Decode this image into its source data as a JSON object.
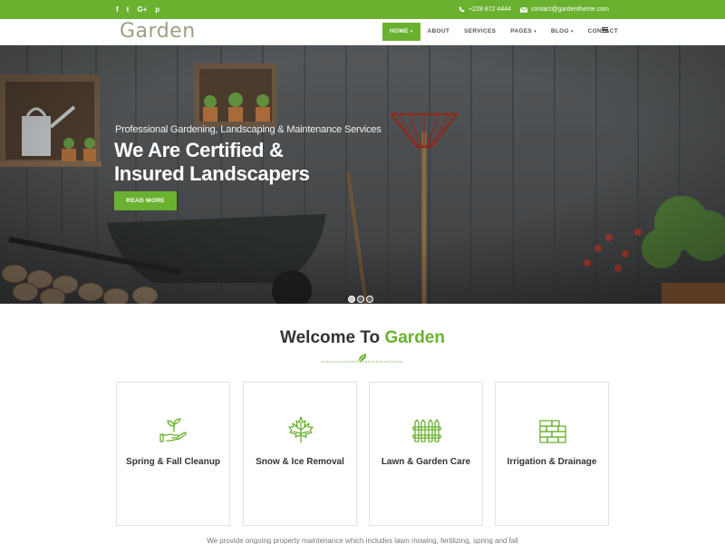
{
  "colors": {
    "brand": "#6ab130",
    "text_dark": "#333333"
  },
  "topbar": {
    "social": [
      {
        "icon": "facebook-icon",
        "glyph": "f"
      },
      {
        "icon": "twitter-icon",
        "glyph": "t"
      },
      {
        "icon": "google-plus-icon",
        "glyph": "G+"
      },
      {
        "icon": "pinterest-icon",
        "glyph": "p"
      }
    ],
    "phone": "+228 872 4444",
    "email": "contact@gardentheme.com"
  },
  "header": {
    "logo": "Garden",
    "nav": [
      {
        "label": "HOME",
        "caret": "▾",
        "active": true
      },
      {
        "label": "ABOUT",
        "caret": ""
      },
      {
        "label": "SERVICES",
        "caret": ""
      },
      {
        "label": "PAGES",
        "caret": "▾"
      },
      {
        "label": "BLOG",
        "caret": "▾"
      },
      {
        "label": "CONTACT",
        "caret": ""
      }
    ],
    "menu_icon": "hamburger-icon"
  },
  "hero": {
    "subtitle": "Professional Gardening, Landscaping & Maintenance Services",
    "title_line1": "We Are Certified &",
    "title_line2": "Insured Landscapers",
    "button": "READ MORE",
    "slide_count": 3,
    "active_slide": 1
  },
  "welcome": {
    "prefix": "Welcome To ",
    "accent": "Garden",
    "divider_icon": "leaf-icon"
  },
  "services": [
    {
      "title": "Spring & Fall Cleanup",
      "icon": "hand-plant-icon"
    },
    {
      "title": "Snow & Ice Removal",
      "icon": "maple-leaf-icon"
    },
    {
      "title": "Lawn & Garden Care",
      "icon": "fence-icon"
    },
    {
      "title": "Irrigation & Drainage",
      "icon": "brick-wall-icon"
    }
  ],
  "description": "We provide ongoing property maintenance which includes lawn mowing, fertilizing, spring and fall"
}
